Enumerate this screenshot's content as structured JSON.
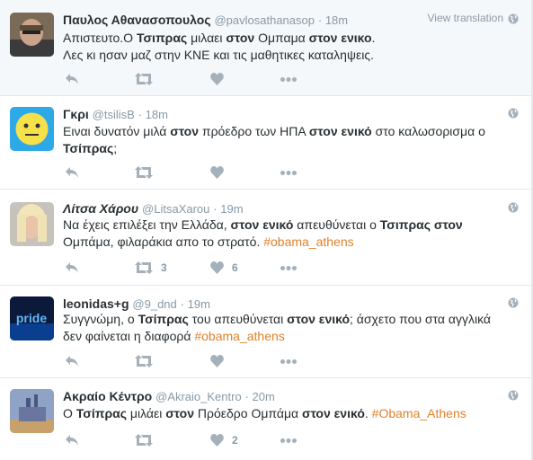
{
  "colors": {
    "hashtag": "#e0812a",
    "muted": "#8899a6",
    "text": "#292f33"
  },
  "view_translation": "View translation",
  "tweets": [
    {
      "fullname": "Παυλος Αθανασοπουλος",
      "username": "@pavlosathanasop",
      "time": "18m",
      "line1": [
        "Απιστευτο.Ο ",
        "Τσιπρας",
        " μιλαει ",
        "στον",
        " Ομπαμα ",
        "στον ενικο",
        "."
      ],
      "line2": "Λες κι ησαν μαζ στην ΚΝΕ και τις μαθητικες καταληψεις.",
      "retweets": "",
      "likes": ""
    },
    {
      "fullname": "Γκρι",
      "username": "@tsilisB",
      "time": "18m",
      "line1": [
        "Ειναι δυνατόν μιλά ",
        "στον",
        " πρόεδρο των ΗΠΑ ",
        "στον ενικό",
        " στο καλωσορισμα ο"
      ],
      "line2": [
        "Τσίπρας",
        ";"
      ],
      "retweets": "",
      "likes": ""
    },
    {
      "fullname": "Λίτσα Χάρου",
      "username": "@LitsaXarou",
      "time": "19m",
      "line1": [
        "Να έχεις επιλέξει την Ελλάδα, ",
        "στον ενικό",
        " απευθύνεται ο ",
        "Τσιπρας στον"
      ],
      "line2": [
        "Ομπάμα, φιλαράκια απο το στρατό. ",
        "#obama_athens"
      ],
      "retweets": "3",
      "likes": "6"
    },
    {
      "fullname": "leonidas+g",
      "username": "@9_dnd",
      "time": "19m",
      "line1": [
        "Συγγνώμη, ο ",
        "Τσίπρας",
        " του απευθύνεται ",
        "στον ενικό",
        "; άσχετο που στα αγγλικά"
      ],
      "line2": [
        "δεν φαίνεται η διαφορά ",
        "#obama_athens"
      ],
      "retweets": "",
      "likes": ""
    },
    {
      "fullname": "Ακραίο Κέντρο",
      "username": "@Akraio_Kentro",
      "time": "20m",
      "line1": [
        "Ο ",
        "Τσίπρας",
        " μιλάει ",
        "στον",
        " Πρόεδρο Ομπάμα ",
        "στον ενικό",
        ". ",
        "#Obama_Athens"
      ],
      "line2": "",
      "retweets": "",
      "likes": "2"
    }
  ]
}
